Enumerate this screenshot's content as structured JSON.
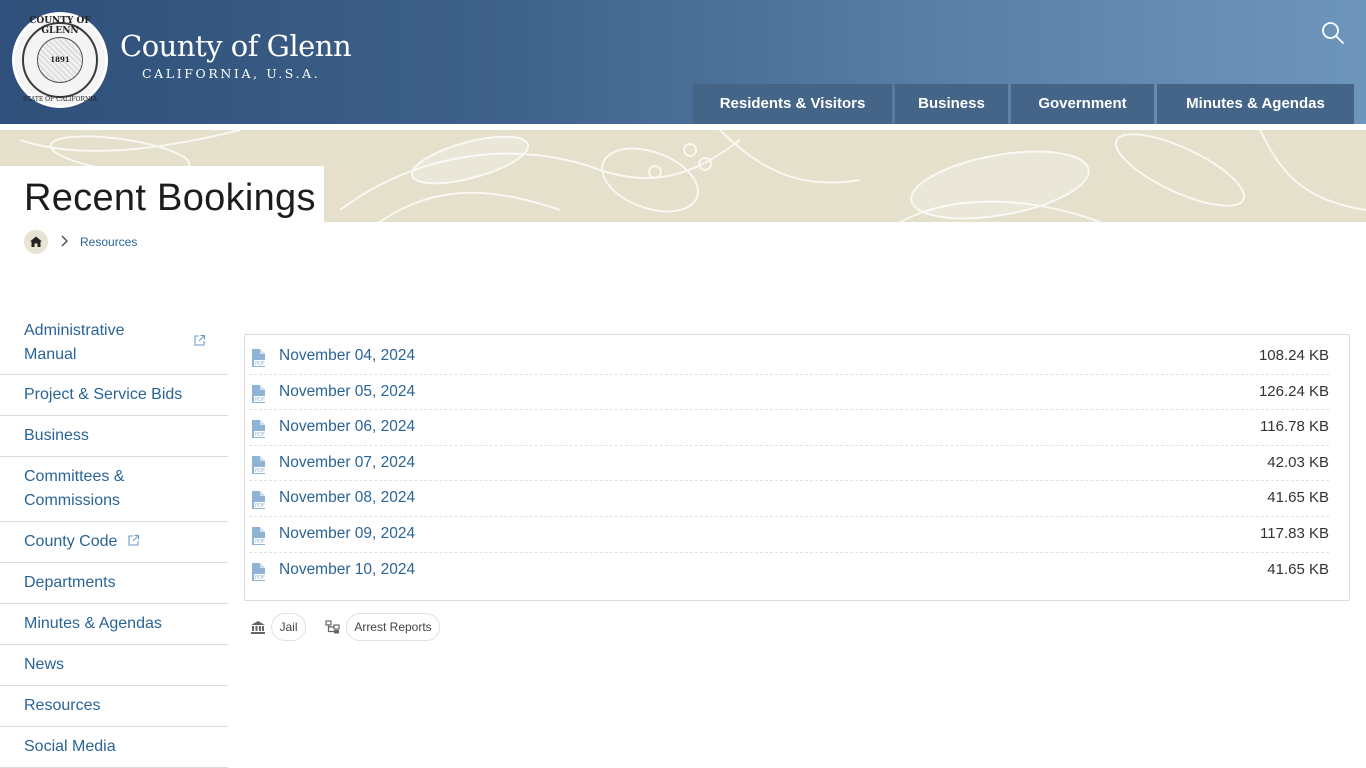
{
  "site": {
    "title": "County of Glenn",
    "subtitle": "CALIFORNIA, U.S.A.",
    "seal": {
      "top_text": "COUNTY OF GLENN",
      "year": "1891",
      "bottom_text": "STATE OF CALIFORNIA"
    }
  },
  "nav": {
    "items": [
      {
        "label": "Residents & Visitors"
      },
      {
        "label": "Business"
      },
      {
        "label": "Government"
      },
      {
        "label": "Minutes & Agendas"
      }
    ]
  },
  "page": {
    "title": "Recent Bookings"
  },
  "breadcrumb": {
    "home_icon": "home-icon",
    "items": [
      {
        "label": "Resources"
      }
    ]
  },
  "sidebar": {
    "items": [
      {
        "label": "Administrative Manual",
        "external": true
      },
      {
        "label": "Project & Service Bids"
      },
      {
        "label": "Business"
      },
      {
        "label": "Committees & Commissions"
      },
      {
        "label": "County Code",
        "external": true
      },
      {
        "label": "Departments"
      },
      {
        "label": "Minutes & Agendas"
      },
      {
        "label": "News"
      },
      {
        "label": "Resources"
      },
      {
        "label": "Social Media"
      }
    ]
  },
  "files": [
    {
      "name": "November 04, 2024",
      "size": "108.24 KB",
      "icon": "pdf-file-icon"
    },
    {
      "name": "November 05, 2024",
      "size": "126.24 KB",
      "icon": "pdf-file-icon"
    },
    {
      "name": "November 06, 2024",
      "size": "116.78 KB",
      "icon": "pdf-file-icon"
    },
    {
      "name": "November 07, 2024",
      "size": "42.03 KB",
      "icon": "pdf-file-icon"
    },
    {
      "name": "November 08, 2024",
      "size": "41.65 KB",
      "icon": "pdf-file-icon"
    },
    {
      "name": "November 09, 2024",
      "size": "117.83 KB",
      "icon": "pdf-file-icon"
    },
    {
      "name": "November 10, 2024",
      "size": "41.65 KB",
      "icon": "pdf-file-icon"
    }
  ],
  "tags": {
    "department": {
      "label": "Jail",
      "icon": "building-icon"
    },
    "category": {
      "label": "Arrest Reports",
      "icon": "hierarchy-icon"
    }
  },
  "colors": {
    "header_start": "#2e507a",
    "header_end": "#6e95bb",
    "nav_bg": "#446488",
    "link": "#2a6496",
    "banner": "#e4e0cc"
  }
}
